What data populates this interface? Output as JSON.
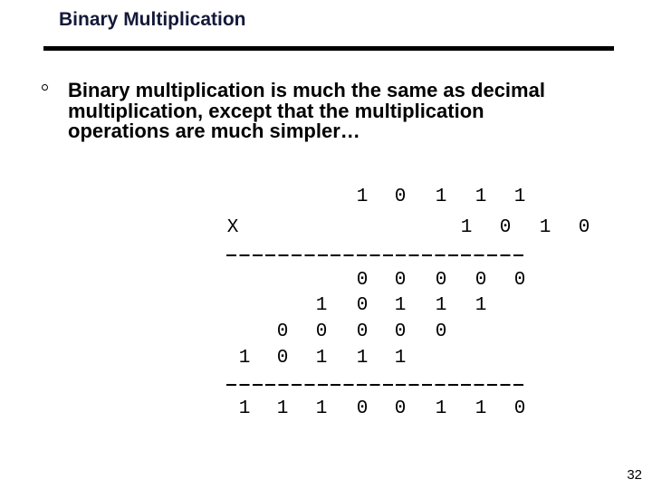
{
  "slide": {
    "title": "Binary Multiplication",
    "page_number": "32",
    "title_color": "#14193a"
  },
  "bullet": {
    "icon": "hollow-circle-bullet",
    "lines": [
      "Binary multiplication is much the same as decimal",
      "multiplication, except that the multiplication",
      "operations are much simpler…"
    ]
  },
  "calculation": {
    "operator": "X",
    "multiplicand": [
      "1",
      "0",
      "1",
      "1",
      "1"
    ],
    "multiplier": [
      "1",
      "0",
      "1",
      "0"
    ],
    "partial_products": [
      [
        "0",
        "0",
        "0",
        "0",
        "0"
      ],
      [
        "1",
        "0",
        "1",
        "1",
        "1"
      ],
      [
        "0",
        "0",
        "0",
        "0",
        "0"
      ],
      [
        "1",
        "0",
        "1",
        "1",
        "1"
      ]
    ],
    "result": [
      "1",
      "1",
      "1",
      "0",
      "0",
      "1",
      "1",
      "0"
    ]
  }
}
